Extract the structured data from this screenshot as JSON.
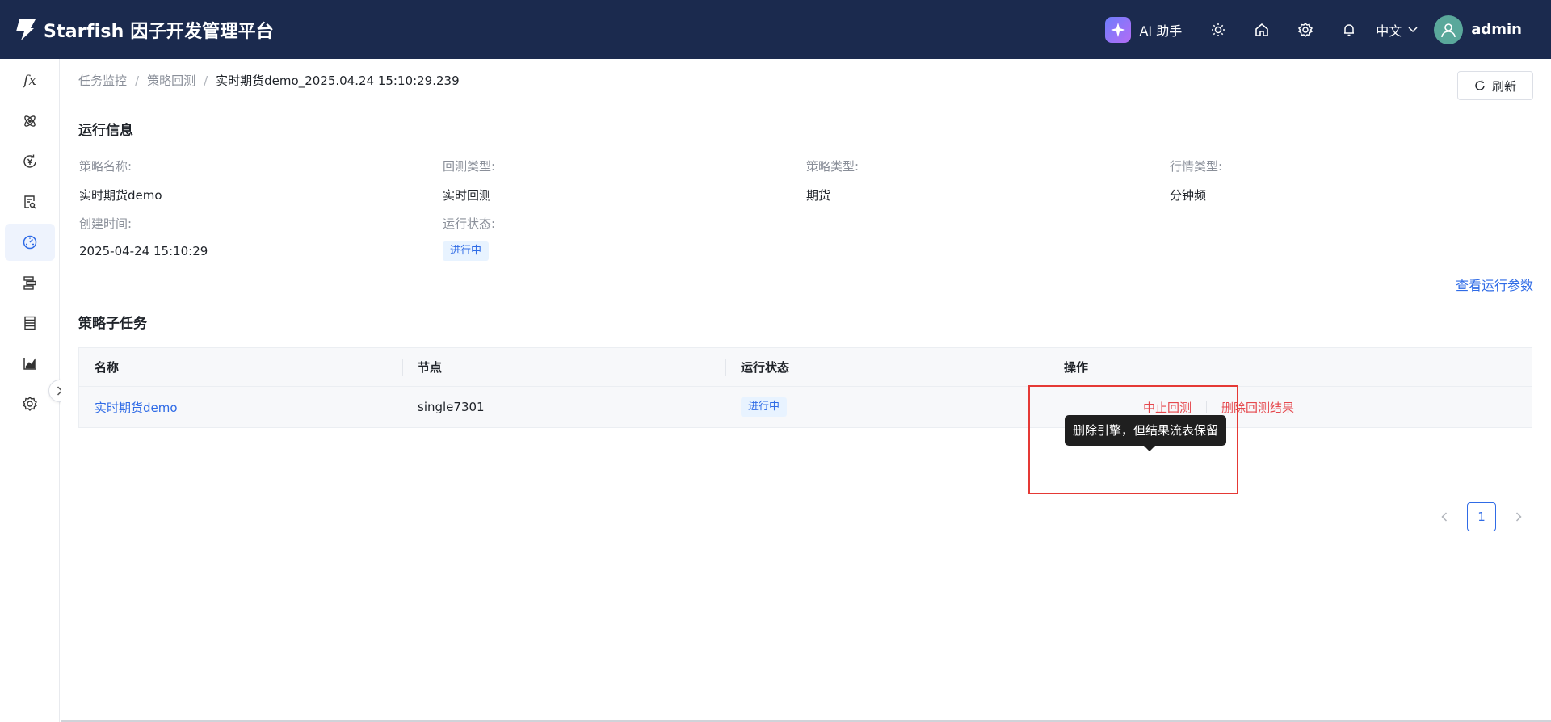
{
  "header": {
    "title": "Starfish 因子开发管理平台",
    "ai_label": "AI 助手",
    "lang_label": "中文",
    "user_name": "admin"
  },
  "sidebar": {
    "items": [
      {
        "name": "fx",
        "label": "fx"
      },
      {
        "name": "atom-icon"
      },
      {
        "name": "currency-cycle-icon"
      },
      {
        "name": "report-search-icon"
      },
      {
        "name": "dashboard-gauge-icon",
        "active": true
      },
      {
        "name": "strategy-steps-icon"
      },
      {
        "name": "table-list-icon"
      },
      {
        "name": "line-chart-icon"
      },
      {
        "name": "gear-icon"
      }
    ]
  },
  "breadcrumb": {
    "items": [
      "任务监控",
      "策略回测"
    ],
    "current": "实时期货demo_2025.04.24 15:10:29.239"
  },
  "refresh_label": "刷新",
  "run_info": {
    "title": "运行信息",
    "fields": [
      {
        "label": "策略名称:",
        "value": "实时期货demo"
      },
      {
        "label": "回测类型:",
        "value": "实时回测"
      },
      {
        "label": "策略类型:",
        "value": "期货"
      },
      {
        "label": "行情类型:",
        "value": "分钟频"
      },
      {
        "label": "创建时间:",
        "value": "2025-04-24 15:10:29"
      },
      {
        "label": "运行状态:",
        "value": "进行中"
      }
    ],
    "view_params_label": "查看运行参数"
  },
  "subtasks": {
    "title": "策略子任务",
    "columns": [
      "名称",
      "节点",
      "运行状态",
      "操作"
    ],
    "rows": [
      {
        "name": "实时期货demo",
        "node": "single7301",
        "status": "进行中",
        "actions": [
          "中止回测",
          "删除回测结果"
        ]
      }
    ],
    "tooltip": "删除引擎，但结果流表保留"
  },
  "pagination": {
    "current_page": "1"
  },
  "colors": {
    "header_bg": "#1b2a4e",
    "primary": "#2f6be6",
    "danger": "#e5484d",
    "highlight": "#e53935"
  }
}
